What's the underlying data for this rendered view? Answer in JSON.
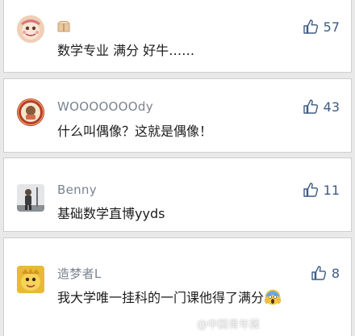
{
  "comments": [
    {
      "username": "",
      "comment": "数学专业 满分 好牛……",
      "likes": "57"
    },
    {
      "username": "WOOOOOOOdy",
      "comment": "什么叫偶像？这就是偶像！",
      "likes": "43"
    },
    {
      "username": "Benny",
      "comment": "基础数学直博yyds",
      "likes": "11"
    },
    {
      "username": "造梦者L",
      "comment": "我大学唯一挂科的一门课他得了满分",
      "likes": "8"
    }
  ],
  "watermark": "@中国青年报",
  "colors": {
    "accent": "#3e5b84",
    "username": "#7a8391",
    "text": "#1c1c1c",
    "background": "#e9e9e9"
  },
  "icons": {
    "like": "thumbs-up-icon",
    "emoji": "screaming-face-emoji"
  }
}
